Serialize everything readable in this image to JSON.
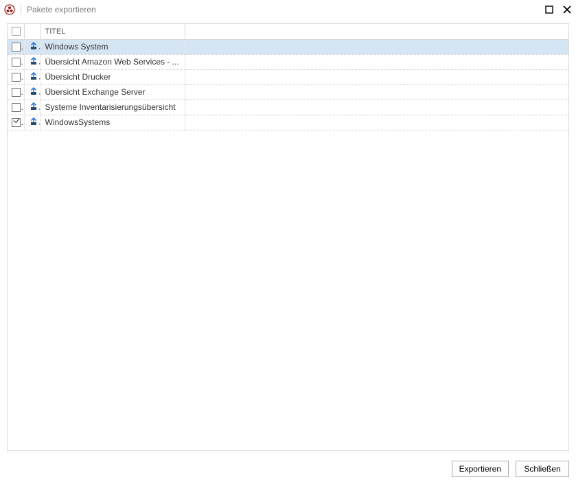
{
  "window": {
    "title": "Pakete exportieren"
  },
  "table": {
    "header": {
      "title_label": "TITEL"
    },
    "rows": [
      {
        "checked": false,
        "title": "Windows System",
        "selected": true
      },
      {
        "checked": false,
        "title": "Übersicht Amazon Web Services - ...",
        "selected": false
      },
      {
        "checked": false,
        "title": "Übersicht Drucker",
        "selected": false
      },
      {
        "checked": false,
        "title": "Übersicht Exchange Server",
        "selected": false
      },
      {
        "checked": false,
        "title": "Systeme Inventarisierungsübersicht",
        "selected": false
      },
      {
        "checked": true,
        "title": "WindowsSystems",
        "selected": false
      }
    ]
  },
  "buttons": {
    "export": "Exportieren",
    "close": "Schließen"
  }
}
